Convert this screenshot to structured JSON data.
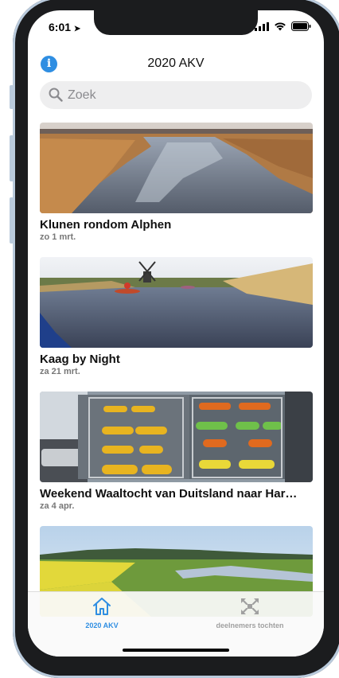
{
  "status_bar": {
    "time": "6:01"
  },
  "header": {
    "title": "2020 AKV"
  },
  "search": {
    "placeholder": "Zoek"
  },
  "events": [
    {
      "title": "Klunen rondom Alphen",
      "date": "zo 1 mrt."
    },
    {
      "title": "Kaag by Night",
      "date": "za 21 mrt."
    },
    {
      "title": "Weekend Waaltocht van Duitsland naar Har…",
      "date": "za 4 apr."
    }
  ],
  "tabs": [
    {
      "label": "2020 AKV",
      "active": true,
      "icon": "home-icon"
    },
    {
      "label": "deelnemers tochten",
      "active": false,
      "icon": "expand-arrows-icon"
    }
  ],
  "colors": {
    "accent": "#2f8ee2",
    "inactive": "#a0a0a0"
  }
}
